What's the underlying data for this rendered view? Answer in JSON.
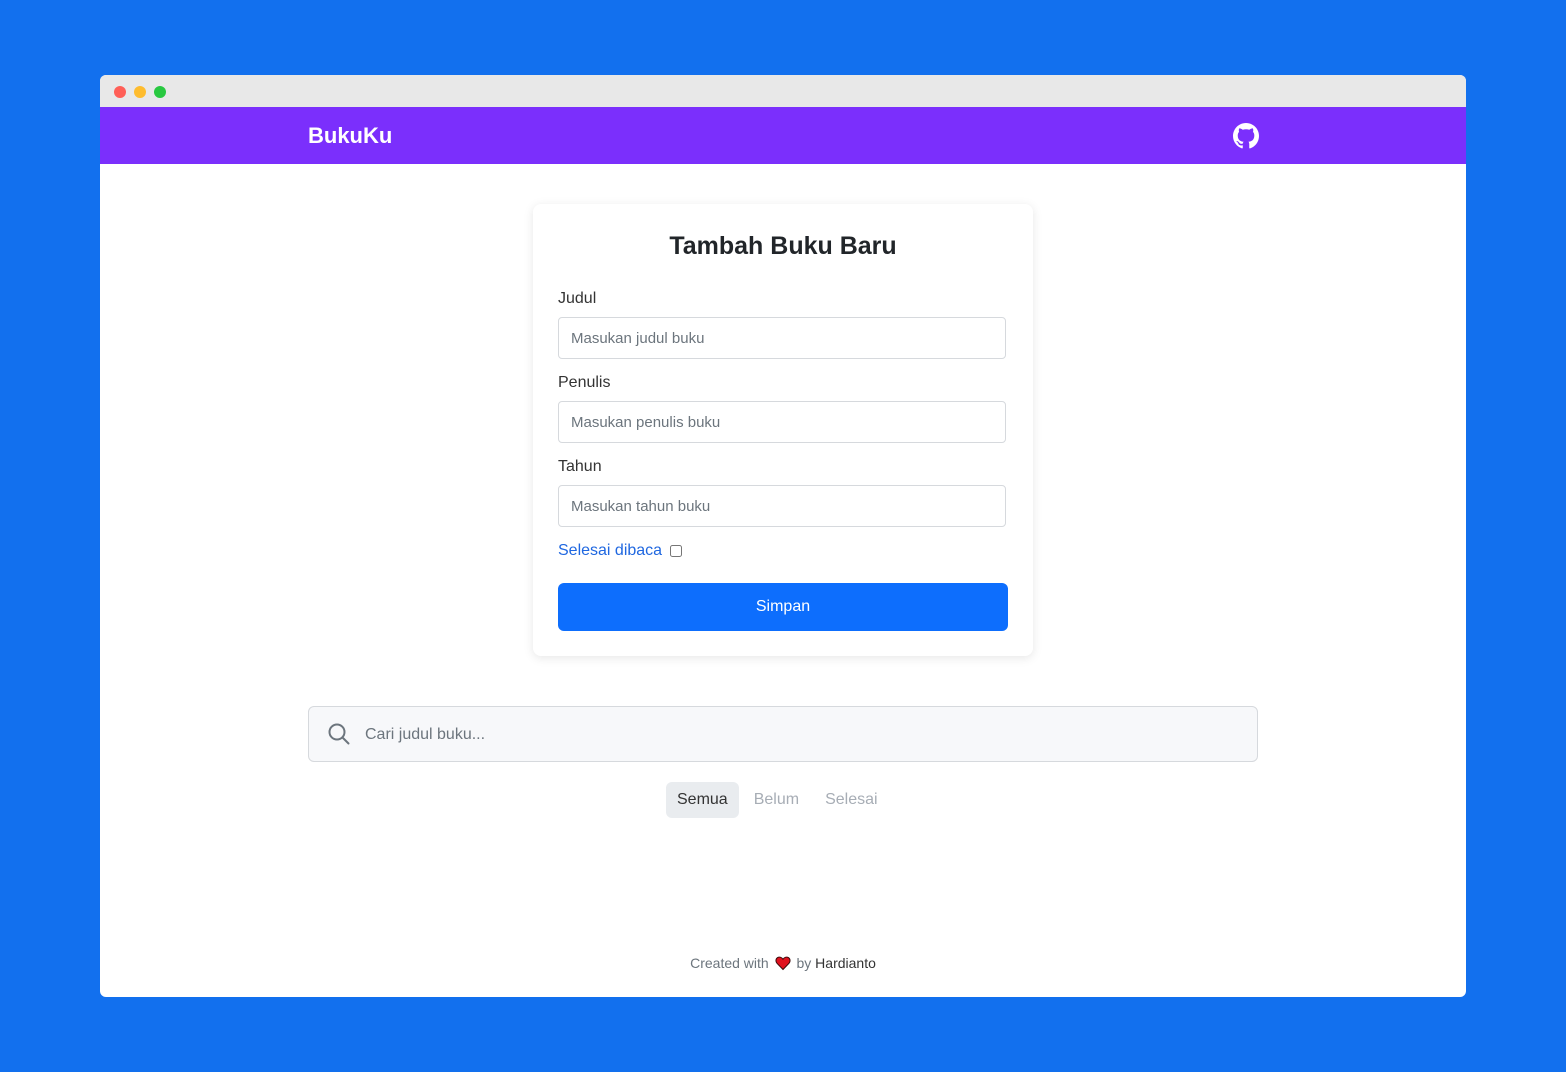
{
  "navbar": {
    "brand": "BukuKu",
    "github_icon": "github-icon"
  },
  "form": {
    "title": "Tambah Buku Baru",
    "fields": [
      {
        "label": "Judul",
        "placeholder": "Masukan judul buku",
        "value": ""
      },
      {
        "label": "Penulis",
        "placeholder": "Masukan penulis buku",
        "value": ""
      },
      {
        "label": "Tahun",
        "placeholder": "Masukan tahun buku",
        "value": ""
      }
    ],
    "checkbox_label": "Selesai dibaca",
    "checkbox_checked": false,
    "submit_label": "Simpan"
  },
  "search": {
    "placeholder": "Cari judul buku...",
    "icon": "search-icon"
  },
  "filters": [
    {
      "label": "Semua",
      "active": true
    },
    {
      "label": "Belum",
      "active": false
    },
    {
      "label": "Selesai",
      "active": false
    }
  ],
  "footer": {
    "prefix": "Created with",
    "middle": "by",
    "author": "Hardianto",
    "icon": "heart-icon"
  },
  "colors": {
    "background": "#1270EE",
    "navbar": "#7B2FFC",
    "primary_button": "#0D6EFD",
    "checkbox_label": "#1F67E0"
  }
}
